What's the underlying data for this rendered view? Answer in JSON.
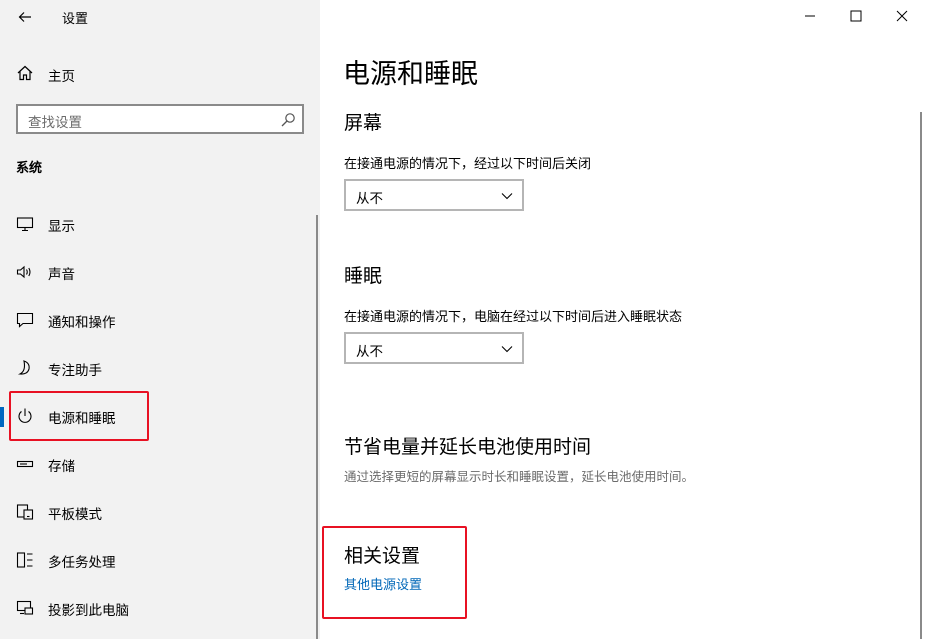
{
  "window": {
    "title": "设置",
    "icons": {
      "back": "back-arrow-icon",
      "minimize": "minimize-icon",
      "maximize": "maximize-icon",
      "close": "close-icon"
    }
  },
  "sidebar": {
    "home_label": "主页",
    "search_placeholder": "查找设置",
    "section_title": "系统",
    "items": [
      {
        "label": "显示",
        "icon": "display-icon"
      },
      {
        "label": "声音",
        "icon": "speaker-icon"
      },
      {
        "label": "通知和操作",
        "icon": "notification-icon"
      },
      {
        "label": "专注助手",
        "icon": "moon-icon"
      },
      {
        "label": "电源和睡眠",
        "icon": "power-icon",
        "selected": true
      },
      {
        "label": "存储",
        "icon": "storage-icon"
      },
      {
        "label": "平板模式",
        "icon": "tablet-icon"
      },
      {
        "label": "多任务处理",
        "icon": "multitasking-icon"
      },
      {
        "label": "投影到此电脑",
        "icon": "project-icon"
      }
    ]
  },
  "main": {
    "page_title": "电源和睡眠",
    "screen": {
      "heading": "屏幕",
      "description": "在接通电源的情况下，经过以下时间后关闭",
      "value": "从不"
    },
    "sleep": {
      "heading": "睡眠",
      "description": "在接通电源的情况下，电脑在经过以下时间后进入睡眠状态",
      "value": "从不"
    },
    "battery": {
      "heading": "节省电量并延长电池使用时间",
      "description": "通过选择更短的屏幕显示时长和睡眠设置，延长电池使用时间。"
    },
    "related": {
      "heading": "相关设置",
      "link": "其他电源设置"
    }
  },
  "colors": {
    "sidebar_bg": "#f2f2f2",
    "accent": "#0067c0",
    "link": "#0067b8",
    "highlight": "#e81123"
  }
}
